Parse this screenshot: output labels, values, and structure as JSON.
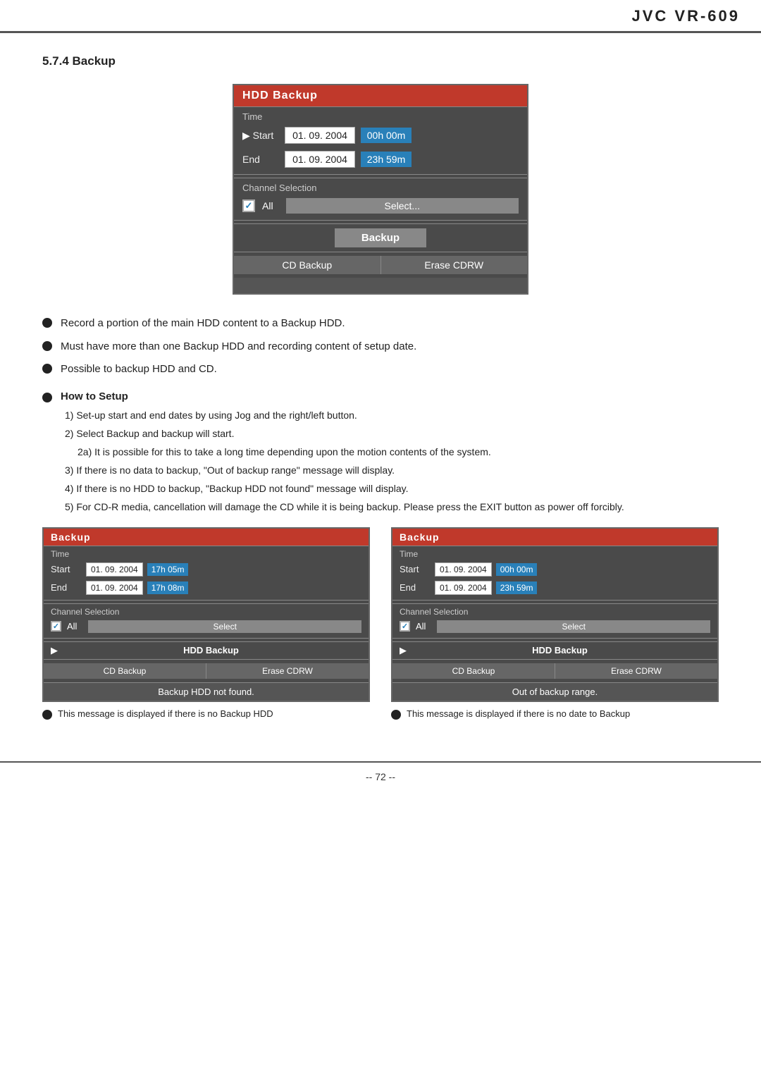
{
  "header": {
    "title": "JVC VR-609"
  },
  "section": {
    "heading": "5.7.4 Backup"
  },
  "main_panel": {
    "title": "HDD Backup",
    "time_label": "Time",
    "start_label": "Start",
    "end_label": "End",
    "start_date": "01. 09. 2004",
    "start_time": "00h 00m",
    "end_date": "01. 09. 2004",
    "end_time": "23h 59m",
    "channel_selection_label": "Channel Selection",
    "all_label": "All",
    "select_btn": "Select...",
    "backup_btn": "Backup",
    "cd_backup_btn": "CD Backup",
    "erase_btn": "Erase CDRW"
  },
  "bullets": [
    "Record a portion of the main HDD content to a Backup HDD.",
    "Must have more than one Backup HDD and recording content of setup date.",
    "Possible to backup HDD and CD."
  ],
  "how_to_setup": {
    "heading": "How to Setup",
    "steps": [
      "1) Set-up start and end dates by using Jog and the right/left button.",
      "2) Select Backup and backup will start.",
      "2a) It is possible for this to take a long time depending upon the motion contents of the system.",
      "3) If there is no data to backup, \"Out of backup range\" message will display.",
      "4) If there is no HDD to backup, \"Backup HDD not found\" message will display.",
      "5) For CD-R media, cancellation will damage the CD while it is being backup. Please press the EXIT button as power off forcibly."
    ]
  },
  "left_panel": {
    "title": "Backup",
    "time_label": "Time",
    "start_label": "Start",
    "end_label": "End",
    "start_date": "01. 09. 2004",
    "start_time": "17h 05m",
    "end_date": "01. 09. 2004",
    "end_time": "17h 08m",
    "channel_selection_label": "Channel Selection",
    "all_label": "All",
    "select_btn": "Select",
    "hdd_backup_label": "HDD Backup",
    "cd_backup_btn": "CD Backup",
    "erase_btn": "Erase CDRW",
    "message": "Backup HDD not found.",
    "caption": "This message is displayed if there is no Backup HDD"
  },
  "right_panel": {
    "title": "Backup",
    "time_label": "Time",
    "start_label": "Start",
    "end_label": "End",
    "start_date": "01. 09. 2004",
    "start_time": "00h 00m",
    "end_date": "01. 09. 2004",
    "end_time": "23h 59m",
    "channel_selection_label": "Channel Selection",
    "all_label": "All",
    "select_btn": "Select",
    "hdd_backup_label": "HDD Backup",
    "cd_backup_btn": "CD Backup",
    "erase_btn": "Erase CDRW",
    "message": "Out of backup range.",
    "caption": "This message is displayed if there is no date to Backup"
  },
  "footer": {
    "page": "-- 72 --"
  }
}
